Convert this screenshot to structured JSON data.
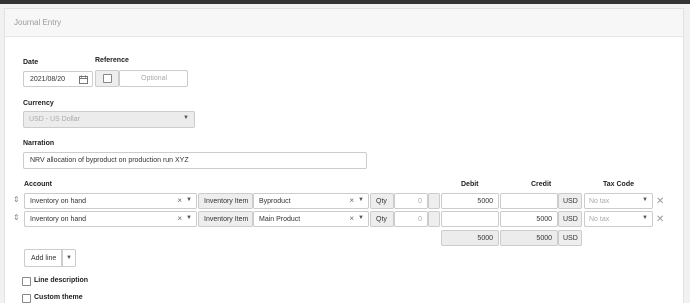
{
  "header": {
    "title": "Journal Entry"
  },
  "form": {
    "date_label": "Date",
    "date_value": "2021/08/20",
    "reference_label": "Reference",
    "reference_placeholder": "Optional",
    "currency_label": "Currency",
    "currency_value": "USD - US Dollar",
    "narration_label": "Narration",
    "narration_value": "NRV allocation of byproduct on production run XYZ"
  },
  "table": {
    "headers": {
      "account": "Account",
      "debit": "Debit",
      "credit": "Credit",
      "tax_code": "Tax Code"
    },
    "rows": [
      {
        "account": "Inventory on hand",
        "item_label": "Inventory Item",
        "item": "Byproduct",
        "qty_label": "Qty",
        "qty": "0",
        "debit": "5000",
        "credit": "",
        "currency": "USD",
        "tax": "No tax"
      },
      {
        "account": "Inventory on hand",
        "item_label": "Inventory Item",
        "item": "Main Product",
        "qty_label": "Qty",
        "qty": "0",
        "debit": "",
        "credit": "5000",
        "currency": "USD",
        "tax": "No tax"
      }
    ],
    "totals": {
      "debit": "5000",
      "credit": "5000",
      "currency": "USD"
    }
  },
  "actions": {
    "add_line": "Add line"
  },
  "options": {
    "line_description": "Line description",
    "custom_theme": "Custom theme"
  },
  "icons": {
    "calendar": "calendar-icon",
    "clear": "clear-icon",
    "caret": "chevron-down-icon",
    "drag": "drag-handle-icon",
    "remove": "remove-row-icon"
  }
}
